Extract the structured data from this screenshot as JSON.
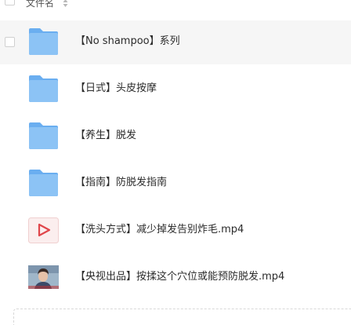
{
  "header": {
    "column_label": "文件名"
  },
  "files": [
    {
      "name": "【No shampoo】系列",
      "type": "folder"
    },
    {
      "name": "【日式】头皮按摩",
      "type": "folder"
    },
    {
      "name": "【养生】脱发",
      "type": "folder"
    },
    {
      "name": "【指南】防脱发指南",
      "type": "folder"
    },
    {
      "name": "【洗头方式】减少掉发告别炸毛.mp4",
      "type": "video"
    },
    {
      "name": "【央视出品】按揉这个穴位或能预防脱发.mp4",
      "type": "video-thumbnail"
    }
  ],
  "colors": {
    "folder": "#6aaef0",
    "folder_light": "#8cc3f5",
    "video_icon": "#e0464b",
    "hover_row": "#f6f6f6"
  }
}
